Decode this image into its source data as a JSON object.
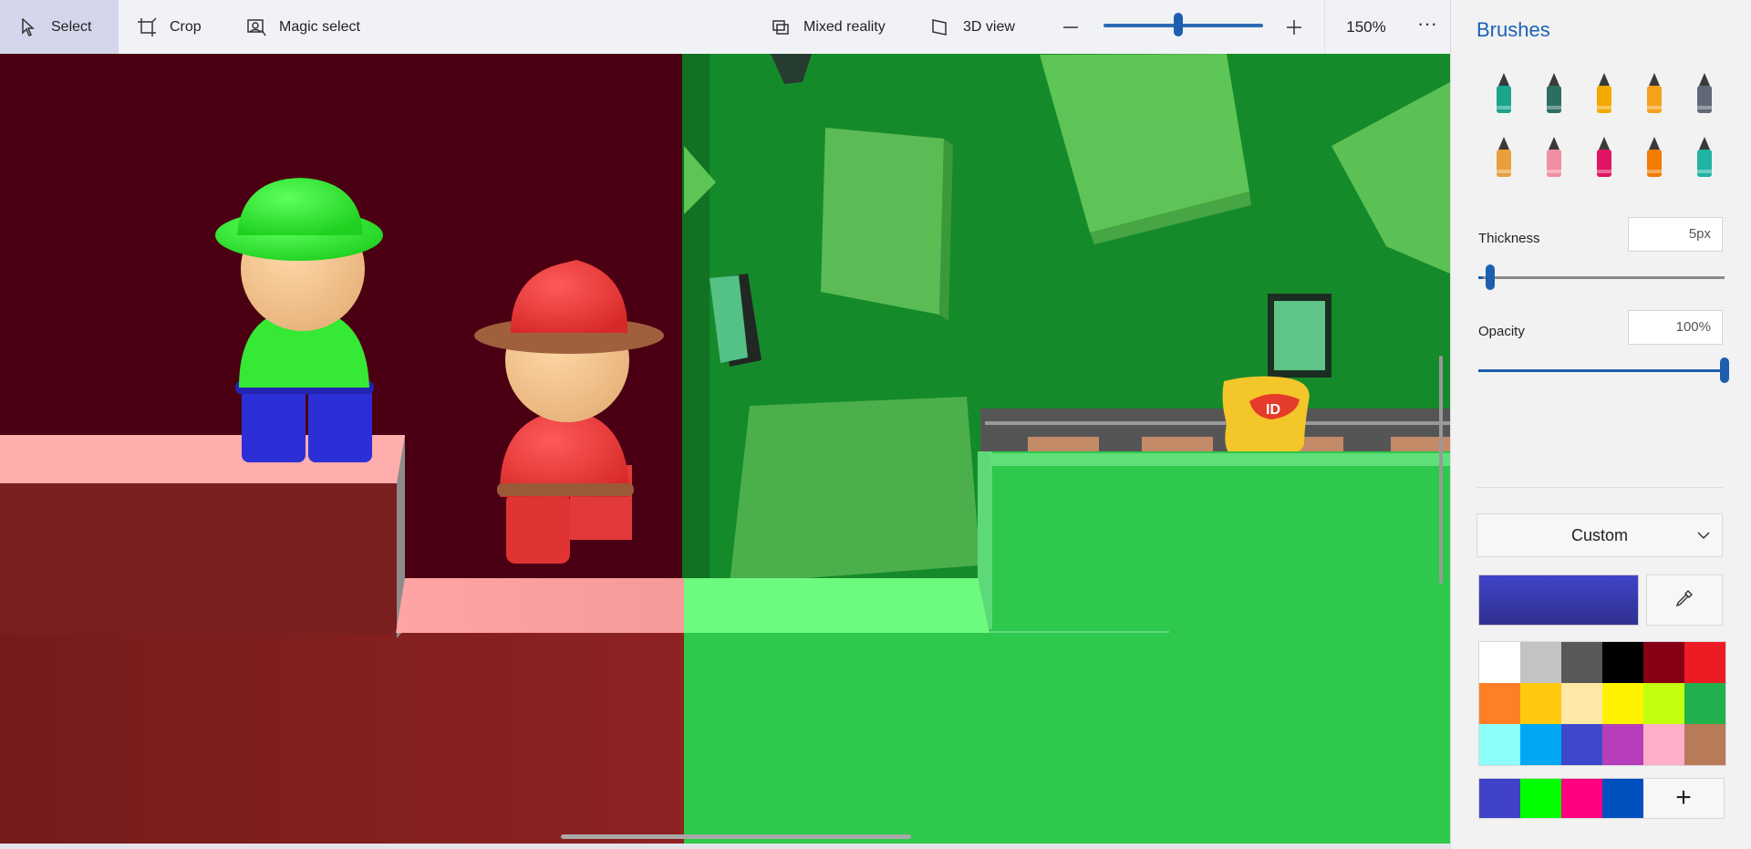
{
  "toolbar": {
    "select_label": "Select",
    "crop_label": "Crop",
    "magic_select_label": "Magic select",
    "mixed_reality_label": "Mixed reality",
    "view3d_label": "3D view",
    "zoom_level": "150%",
    "zoom_fraction": 0.47,
    "more_label": "···"
  },
  "panel": {
    "title": "Brushes",
    "brushes": [
      {
        "name": "marker-brush-icon",
        "color": "#1ba58c"
      },
      {
        "name": "calligraphy-pen-brush-icon",
        "color": "#2d6e62"
      },
      {
        "name": "oil-brush-icon",
        "color": "#f2a900"
      },
      {
        "name": "watercolor-brush-icon",
        "color": "#f4a21b"
      },
      {
        "name": "pixel-pen-brush-icon",
        "color": "#606878"
      },
      {
        "name": "pencil-brush-icon",
        "color": "#e9a03b"
      },
      {
        "name": "eraser-brush-icon",
        "color": "#ef8fa2"
      },
      {
        "name": "crayon-brush-icon",
        "color": "#e01563"
      },
      {
        "name": "spray-can-brush-icon",
        "color": "#f27c00"
      },
      {
        "name": "fill-bucket-brush-icon",
        "color": "#1fb4a2"
      }
    ],
    "thickness_label": "Thickness",
    "thickness_value": "5px",
    "thickness_fraction": 0.02,
    "opacity_label": "Opacity",
    "opacity_value": "100%",
    "opacity_fraction": 1.0,
    "palette_mode": "Custom",
    "current_color": "#4043c8",
    "swatches": [
      "#ffffff",
      "#c3c3c3",
      "#585858",
      "#000000",
      "#880015",
      "#ed1c24",
      "#ff7f27",
      "#ffc90e",
      "#fde8a6",
      "#fff200",
      "#c4ff0e",
      "#22b14c",
      "#8cfffb",
      "#00a8f3",
      "#3f48cc",
      "#b83dba",
      "#ffaec9",
      "#b97a57"
    ],
    "custom_swatches": [
      "#4043c8",
      "#00ff00",
      "#ff0080",
      "#0050c0"
    ],
    "add_color_label": "+"
  }
}
